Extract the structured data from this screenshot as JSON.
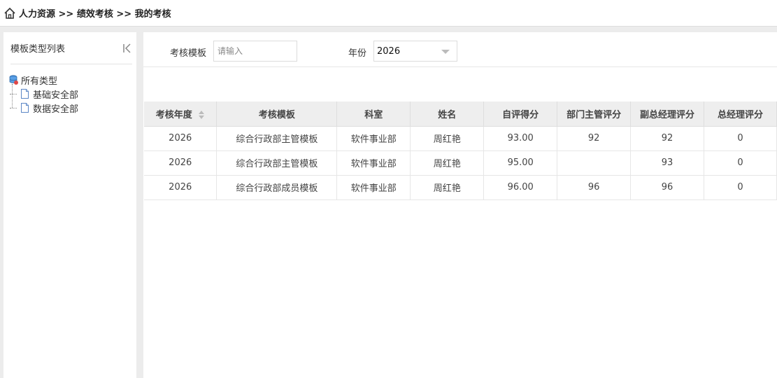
{
  "breadcrumb": {
    "text": "人力资源 >> 绩效考核 >> 我的考核"
  },
  "sidebar": {
    "title": "模板类型列表",
    "tree": {
      "root": "所有类型",
      "children": [
        "基础安全部",
        "数据安全部"
      ]
    }
  },
  "filter": {
    "template_label": "考核模板",
    "template_placeholder": "请输入",
    "year_label": "年份",
    "year_value": "2026"
  },
  "table": {
    "columns": [
      "考核年度",
      "考核模板",
      "科室",
      "姓名",
      "自评得分",
      "部门主管评分",
      "副总经理评分",
      "总经理评分"
    ],
    "rows": [
      [
        "2026",
        "综合行政部主管模板",
        "软件事业部",
        "周红艳",
        "93.00",
        "92",
        "92",
        "0"
      ],
      [
        "2026",
        "综合行政部主管模板",
        "软件事业部",
        "周红艳",
        "95.00",
        "",
        "93",
        "0"
      ],
      [
        "2026",
        "综合行政部成员模板",
        "软件事业部",
        "周红艳",
        "96.00",
        "96",
        "96",
        "0"
      ]
    ]
  },
  "colors": {
    "header_bg": "#eeeeee",
    "page_bg": "#ececec",
    "tree_icon_blue": "#3b82c4"
  },
  "icons": [
    "home-icon",
    "collapse-left-icon",
    "database-icon",
    "document-icon",
    "sort-icon",
    "chevron-down-icon"
  ]
}
